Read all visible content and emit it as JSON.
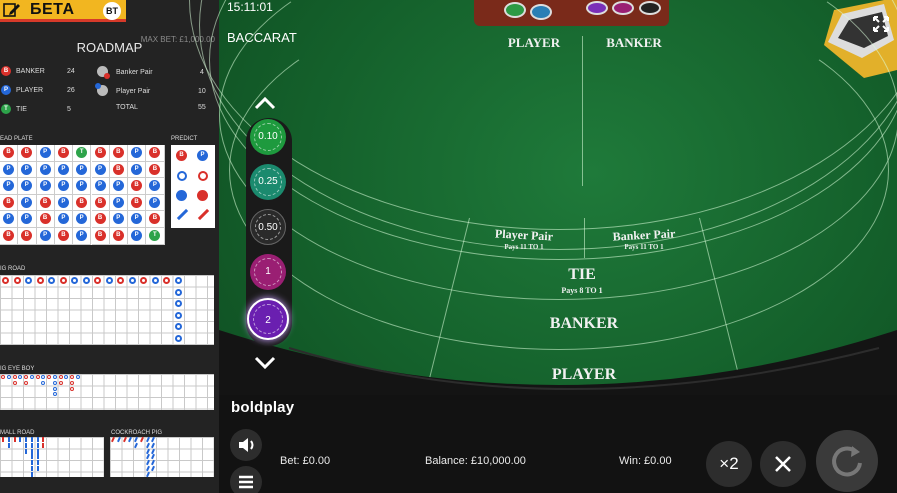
{
  "header": {
    "brand_label": "БЕТА",
    "bt_badge": "BT",
    "max_bet": "MAX BET: £1,000.00",
    "roadmap_title": "ROADMAP"
  },
  "stats": {
    "banker": {
      "icon": "B",
      "label": "BANKER",
      "value": "24"
    },
    "player": {
      "icon": "P",
      "label": "PLAYER",
      "value": "26"
    },
    "tie": {
      "icon": "T",
      "label": "TIE",
      "value": "5"
    },
    "banker_pair": {
      "label": "Banker Pair",
      "value": "4"
    },
    "player_pair": {
      "label": "Player Pair",
      "value": "10"
    },
    "total": {
      "label": "TOTAL",
      "value": "55"
    }
  },
  "sections": {
    "bead_plate": "EAD PLATE",
    "predict": "PREDICT",
    "big_road": "IG ROAD",
    "big_eye_boy": "IG EYE BOY",
    "small_road": "MALL ROAD",
    "cockroach_pig": "COCKROACH PIG"
  },
  "bead_plate": [
    [
      "B",
      "B",
      "P",
      "B",
      "T",
      "B",
      "B",
      "P",
      "B"
    ],
    [
      "P",
      "P",
      "P",
      "P",
      "P",
      "P",
      "B",
      "P",
      "B"
    ],
    [
      "P",
      "P",
      "P",
      "P",
      "P",
      "P",
      "P",
      "B",
      "P"
    ],
    [
      "B",
      "P",
      "B",
      "P",
      "B",
      "B",
      "P",
      "B",
      "P"
    ],
    [
      "P",
      "P",
      "B",
      "P",
      "P",
      "B",
      "P",
      "P",
      "B"
    ],
    [
      "B",
      "B",
      "P",
      "B",
      "P",
      "B",
      "B",
      "P",
      "T"
    ]
  ],
  "predict": {
    "b_label": "B",
    "p_label": "P"
  },
  "colors": {
    "banker": "#d9302a",
    "player": "#2467d8",
    "tie": "#2da34a",
    "felt": "#14602b",
    "accent": "#f2b620"
  },
  "table": {
    "clock": "15:11:01",
    "game_title": "BACCARAT",
    "player_header": "PLAYER",
    "banker_header": "BANKER",
    "player_pair": "Player Pair",
    "player_pair_pays": "Pays 11 TO 1",
    "banker_pair": "Banker Pair",
    "banker_pair_pays": "Pays 11 TO 1",
    "tie": "TIE",
    "tie_pays": "Pays 8 TO 1",
    "banker": "BANKER",
    "player": "PLAYER"
  },
  "chips": [
    {
      "label": "0.10",
      "color": "#1e9a3e"
    },
    {
      "label": "0.25",
      "color": "#1b8a6e"
    },
    {
      "label": "0.50",
      "color": "#2a2a2a"
    },
    {
      "label": "1",
      "color": "#9a1f73"
    },
    {
      "label": "2",
      "color": "#6a1fb0"
    }
  ],
  "footer": {
    "logo": "boldplay",
    "bet": "Bet: £0.00",
    "balance": "Balance: £10,000.00",
    "win": "Win: £0.00",
    "double": "×2"
  },
  "icons": [
    "edit-icon",
    "fullscreen-icon",
    "chevron-up-icon",
    "chevron-down-icon",
    "sound-icon",
    "menu-icon",
    "close-icon",
    "replay-icon"
  ]
}
